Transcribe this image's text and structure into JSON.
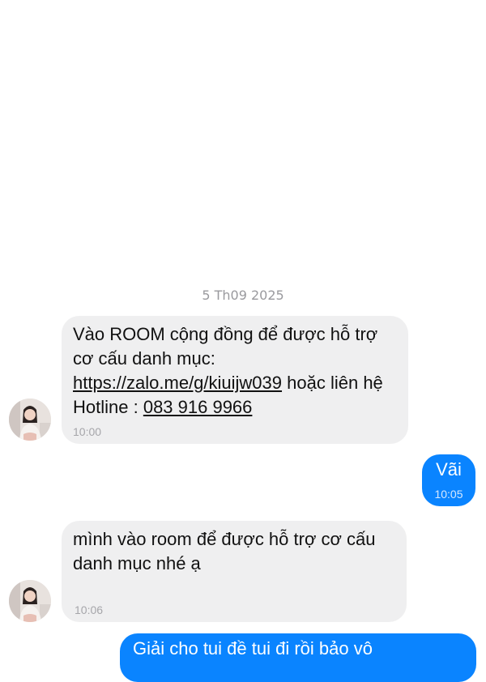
{
  "date_separator": "5 Th09 2025",
  "messages": [
    {
      "direction": "incoming",
      "text_before_link": "Vào ROOM cộng đồng để được hỗ trợ cơ cấu danh mục: ",
      "link_text": "https://zalo.me/g/kiuijw039",
      "text_mid": " hoặc liên hệ Hotline : ",
      "phone": "083 916 9966",
      "time": "10:00"
    },
    {
      "direction": "outgoing",
      "text": "Vãi",
      "time": "10:05"
    },
    {
      "direction": "incoming",
      "text": "mình vào room để được hỗ trợ cơ cấu danh mục nhé ạ",
      "time": "10:06"
    },
    {
      "direction": "outgoing",
      "text": "Giải cho tui đề tui đi rồi bảo vô"
    }
  ],
  "colors": {
    "incoming_bubble": "#efeff0",
    "outgoing_bubble": "#0a84ff",
    "timestamp": "#a6a6aa"
  }
}
